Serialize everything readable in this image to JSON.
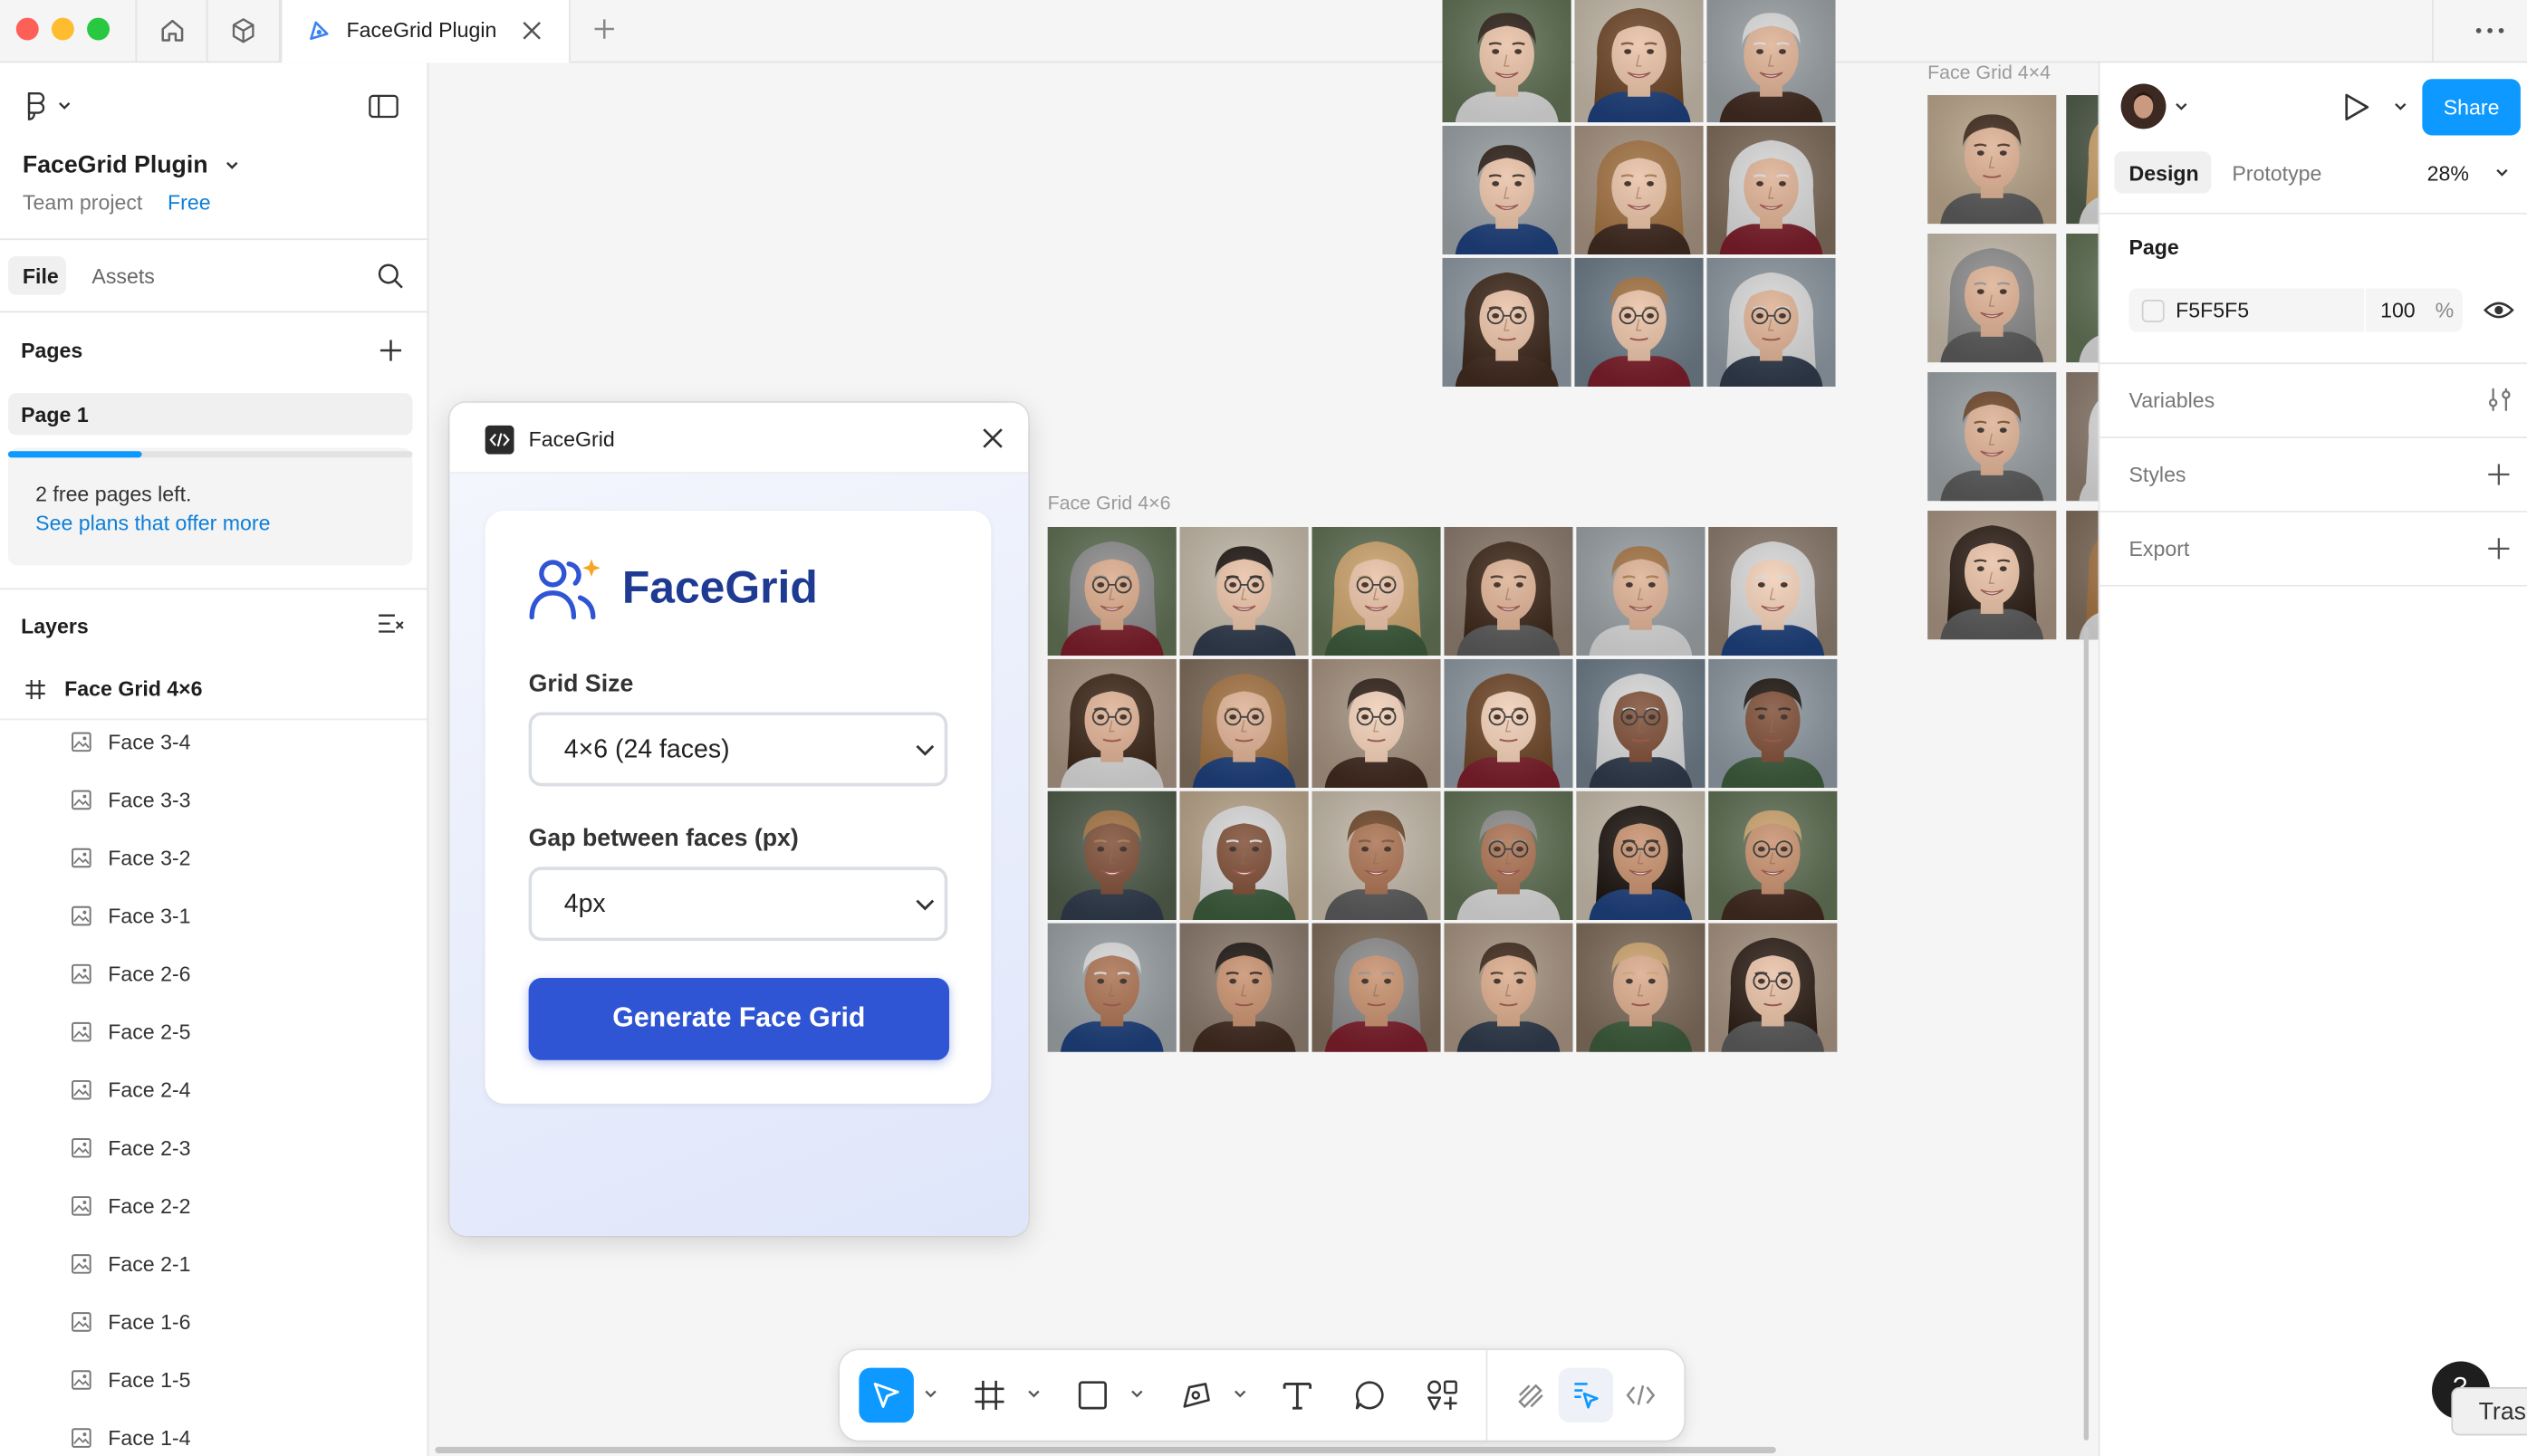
{
  "window": {
    "tab_title": "FaceGrid Plugin"
  },
  "file": {
    "name": "FaceGrid Plugin",
    "team": "Team project",
    "plan": "Free"
  },
  "left_tabs": {
    "file": "File",
    "assets": "Assets"
  },
  "pages": {
    "heading": "Pages",
    "items": [
      "Page 1"
    ],
    "free_left": "2 free pages left.",
    "upgrade_link": "See plans that offer more",
    "free_progress": 0.33
  },
  "layers": {
    "heading": "Layers",
    "frame": "Face Grid 4×6",
    "items": [
      "Face 3-4",
      "Face 3-3",
      "Face 3-2",
      "Face 3-1",
      "Face 2-6",
      "Face 2-5",
      "Face 2-4",
      "Face 2-3",
      "Face 2-2",
      "Face 2-1",
      "Face 1-6",
      "Face 1-5",
      "Face 1-4"
    ]
  },
  "canvas": {
    "frame_main_label": "Face Grid 4×6",
    "frame_side_label": "Face Grid 4×4"
  },
  "plugin": {
    "title": "FaceGrid",
    "brand": "FaceGrid",
    "grid_size_label": "Grid Size",
    "grid_size_value": "4×6 (24 faces)",
    "gap_label": "Gap between faces (px)",
    "gap_value": "4px",
    "generate_button": "Generate Face Grid"
  },
  "right": {
    "share": "Share",
    "tabs": {
      "design": "Design",
      "prototype": "Prototype"
    },
    "zoom": "28%",
    "page_heading": "Page",
    "page_color": "F5F5F5",
    "page_opacity": "100",
    "page_opacity_unit": "%",
    "variables": "Variables",
    "styles": "Styles",
    "export": "Export"
  },
  "corner_text": "Tras",
  "colors": {
    "accent": "#0d99ff",
    "plugin_button": "#2f55d4",
    "brand_text": "#1f3a93"
  }
}
